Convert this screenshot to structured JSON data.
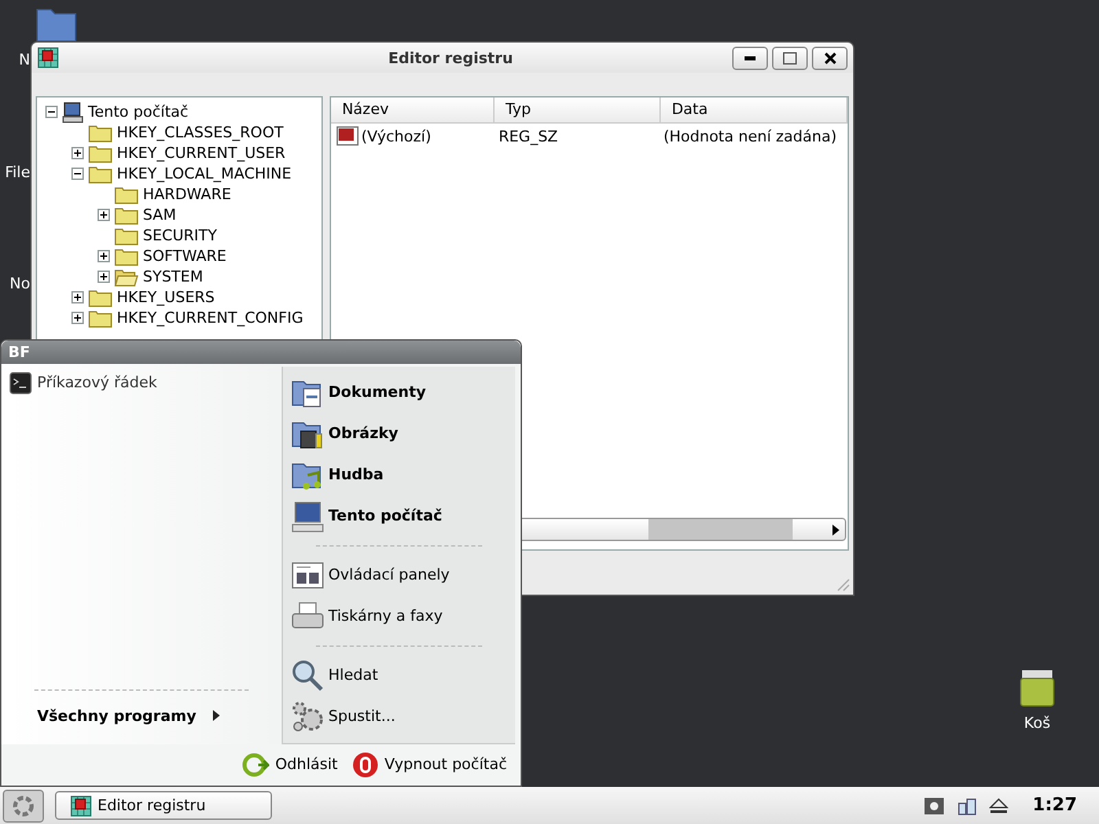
{
  "desktop_icons": [
    {
      "label": "N"
    },
    {
      "label": "File"
    },
    {
      "label": "No"
    },
    {
      "label": "Koš"
    }
  ],
  "window": {
    "title": "Editor registru",
    "tree": [
      {
        "label": "Tento počítač",
        "kind": "computer",
        "expandable": true,
        "expanded": true,
        "children": [
          {
            "label": "HKEY_CLASSES_ROOT",
            "kind": "folder",
            "expandable": false,
            "selected": false
          },
          {
            "label": "HKEY_CURRENT_USER",
            "kind": "folder",
            "expandable": true,
            "expanded": false,
            "selected": false
          },
          {
            "label": "HKEY_LOCAL_MACHINE",
            "kind": "folder",
            "expandable": true,
            "expanded": true,
            "selected": false,
            "children": [
              {
                "label": "HARDWARE",
                "kind": "folder",
                "expandable": false,
                "selected": false
              },
              {
                "label": "SAM",
                "kind": "folder",
                "expandable": true,
                "expanded": false,
                "selected": false
              },
              {
                "label": "SECURITY",
                "kind": "folder",
                "expandable": false,
                "selected": false
              },
              {
                "label": "SOFTWARE",
                "kind": "folder",
                "expandable": true,
                "expanded": false,
                "selected": false
              },
              {
                "label": "SYSTEM",
                "kind": "folder",
                "expandable": true,
                "expanded": false,
                "selected": true
              }
            ]
          },
          {
            "label": "HKEY_USERS",
            "kind": "folder",
            "expandable": true,
            "expanded": false,
            "selected": false
          },
          {
            "label": "HKEY_CURRENT_CONFIG",
            "kind": "folder",
            "expandable": true,
            "expanded": false,
            "selected": false
          }
        ]
      }
    ],
    "columns": [
      "Název",
      "Typ",
      "Data"
    ],
    "rows": [
      {
        "name": "(Výchozí)",
        "type": "REG_SZ",
        "data": "(Hodnota není zadána)"
      }
    ]
  },
  "start_menu": {
    "user": "BF",
    "pinned": [
      {
        "label": "Příkazový řádek"
      }
    ],
    "all_programs": "Všechny programy",
    "places": [
      [
        {
          "label": "Dokumenty",
          "kind": "documents",
          "bold": true
        },
        {
          "label": "Obrázky",
          "kind": "pictures",
          "bold": true
        },
        {
          "label": "Hudba",
          "kind": "music",
          "bold": true
        },
        {
          "label": "Tento počítač",
          "kind": "computer",
          "bold": true
        }
      ],
      [
        {
          "label": "Ovládací panely",
          "kind": "control-panel",
          "bold": false
        },
        {
          "label": "Tiskárny a faxy",
          "kind": "printer",
          "bold": false
        }
      ],
      [
        {
          "label": "Hledat",
          "kind": "search",
          "bold": false
        },
        {
          "label": "Spustit...",
          "kind": "run",
          "bold": false
        }
      ]
    ],
    "logoff": "Odhlásit",
    "shutdown": "Vypnout počítač"
  },
  "taskbar": {
    "tasks": [
      {
        "label": "Editor registru"
      }
    ],
    "clock": "1:27"
  }
}
